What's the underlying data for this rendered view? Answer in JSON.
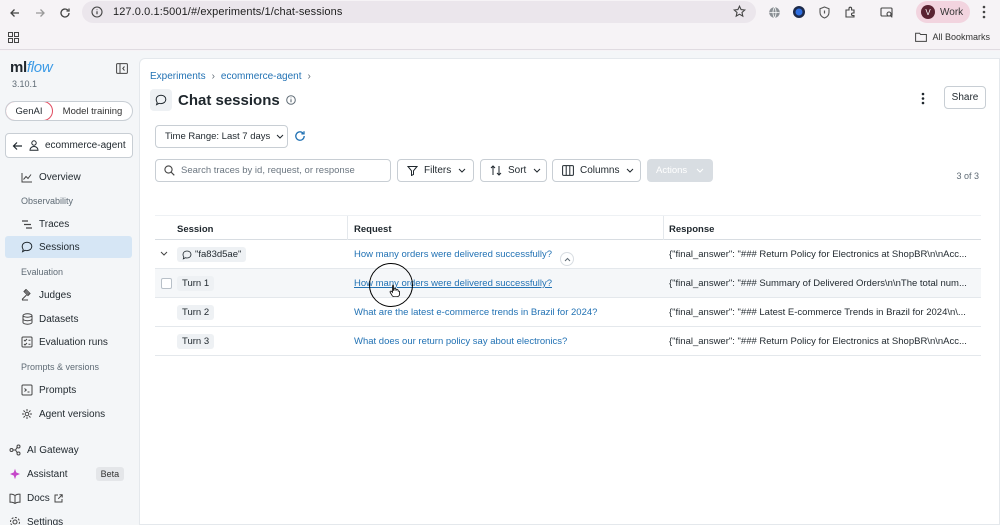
{
  "browser": {
    "url": "127.0.0.1:5001/#/experiments/1/chat-sessions",
    "profile_initial": "V",
    "profile_label": "Work",
    "bookmarks_label": "All Bookmarks"
  },
  "sidebar": {
    "logo_ml": "ml",
    "logo_flow": "flow",
    "version": "3.10.1",
    "mode_genai": "GenAI",
    "mode_training": "Model training",
    "experiment_name": "ecommerce-agent",
    "items": {
      "overview": "Overview",
      "observability_heading": "Observability",
      "traces": "Traces",
      "sessions": "Sessions",
      "evaluation_heading": "Evaluation",
      "judges": "Judges",
      "datasets": "Datasets",
      "evaluation_runs": "Evaluation runs",
      "prompts_heading": "Prompts & versions",
      "prompts": "Prompts",
      "agent_versions": "Agent versions",
      "ai_gateway": "AI Gateway",
      "assistant": "Assistant",
      "beta": "Beta",
      "docs": "Docs",
      "settings": "Settings"
    }
  },
  "main": {
    "breadcrumb_experiments": "Experiments",
    "breadcrumb_experiment": "ecommerce-agent",
    "breadcrumb_sep": "›",
    "title": "Chat sessions",
    "share_label": "Share",
    "time_range_label": "Time Range: Last 7 days",
    "search_placeholder": "Search traces by id, request, or response",
    "filters_label": "Filters",
    "sort_label": "Sort",
    "columns_label": "Columns",
    "actions_label": "Actions",
    "count": "3 of 3"
  },
  "table": {
    "headers": {
      "session": "Session",
      "request": "Request",
      "response": "Response"
    },
    "session_row": {
      "session": "\"fa83d5ae\"",
      "request": "How many orders were delivered successfully?",
      "response": "{\"final_answer\": \"### Return Policy for Electronics at ShopBR\\n\\nAcc..."
    },
    "rows": [
      {
        "turn": "Turn 1",
        "request": "How many orders were delivered successfully?",
        "response": "{\"final_answer\": \"### Summary of Delivered Orders\\n\\nThe total num..."
      },
      {
        "turn": "Turn 2",
        "request": "What are the latest e-commerce trends in Brazil for 2024?",
        "response": "{\"final_answer\": \"### Latest E-commerce Trends in Brazil for 2024\\n\\..."
      },
      {
        "turn": "Turn 3",
        "request": "What does our return policy say about electronics?",
        "response": "{\"final_answer\": \"### Return Policy for Electronics at ShopBR\\n\\nAcc..."
      }
    ]
  },
  "colors": {
    "link": "#2272b4",
    "active_nav": "#d6e6f5",
    "genai_border": "#e04b5f",
    "logo_flow": "#3c9be6"
  }
}
